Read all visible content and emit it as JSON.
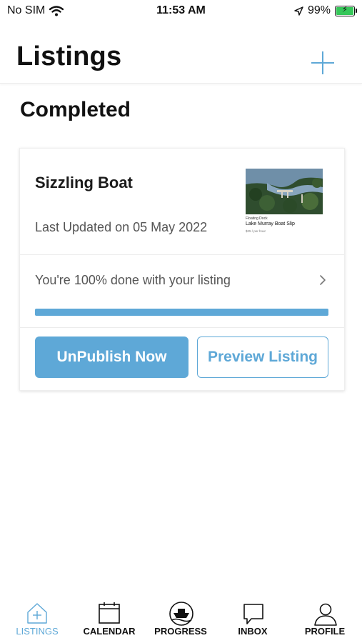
{
  "status_bar": {
    "carrier": "No SIM",
    "time": "11:53 AM",
    "battery": "99%",
    "battery_level": 0.99
  },
  "header": {
    "title": "Listings",
    "add_icon": "plus-icon"
  },
  "section": {
    "title": "Completed"
  },
  "listing": {
    "name": "Sizzling Boat",
    "last_updated": "Last Updated on 05 May 2022",
    "thumbnail": {
      "tag": "Floating Dock",
      "name": "Lake Murray Boat Slip",
      "sub": "$25 / per hour"
    },
    "progress_text": "You're 100% done with your listing",
    "progress": 1.0,
    "unpublish_label": "UnPublish Now",
    "preview_label": "Preview Listing"
  },
  "tabs": [
    {
      "label": "LISTINGS",
      "icon": "home-plus-icon",
      "active": true
    },
    {
      "label": "CALENDAR",
      "icon": "calendar-icon",
      "active": false
    },
    {
      "label": "PROGRESS",
      "icon": "boat-icon",
      "active": false
    },
    {
      "label": "INBOX",
      "icon": "chat-bubble-icon",
      "active": false
    },
    {
      "label": "PROFILE",
      "icon": "person-icon",
      "active": false
    }
  ],
  "colors": {
    "accent": "#5ea8d7",
    "text": "#111111",
    "muted": "#555555"
  }
}
